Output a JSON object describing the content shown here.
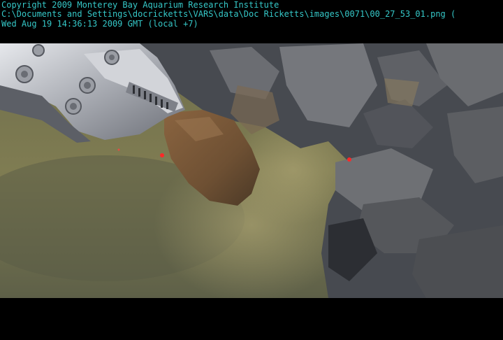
{
  "overlay": {
    "line1": "Copyright 2009 Monterey Bay Aquarium Research Institute",
    "line2": "C:\\Documents and Settings\\docricketts\\VARS\\data\\Doc Ricketts\\images\\0071\\00_27_53_01.png (",
    "line3": "Wed Aug 19 14:36:13 2009 GMT (local +7)",
    "text_color": "#35c8c8"
  },
  "scene": {
    "subject": "remotely operated vehicle manipulator claw gripping a rock sample",
    "colors": {
      "sediment": "#7d7a52",
      "rock_dark": "#3e4048",
      "rock_light": "#7a7c82",
      "rusty_rock": "#7a5a3a",
      "claw_metal": "#c8cad0",
      "laser": "#ff2020"
    }
  }
}
